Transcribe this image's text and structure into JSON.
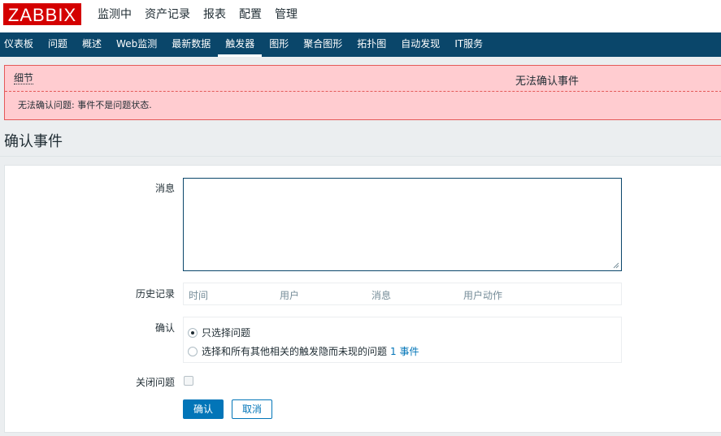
{
  "brand": {
    "logo_text": "ZABBIX",
    "logo_color": "#d40000"
  },
  "top_menu": {
    "items": [
      {
        "label": "监测中",
        "active": true
      },
      {
        "label": "资产记录"
      },
      {
        "label": "报表"
      },
      {
        "label": "配置"
      },
      {
        "label": "管理"
      }
    ]
  },
  "sub_menu": {
    "items": [
      {
        "label": "仪表板"
      },
      {
        "label": "问题"
      },
      {
        "label": "概述"
      },
      {
        "label": "Web监测"
      },
      {
        "label": "最新数据"
      },
      {
        "label": "触发器",
        "active": true
      },
      {
        "label": "图形"
      },
      {
        "label": "聚合图形"
      },
      {
        "label": "拓扑图"
      },
      {
        "label": "自动发现"
      },
      {
        "label": "IT服务"
      }
    ]
  },
  "error": {
    "details_label": "细节",
    "title": "无法确认事件",
    "message": "无法确认问题: 事件不是问题状态."
  },
  "page": {
    "title": "确认事件"
  },
  "form": {
    "message_label": "消息",
    "message_value": "",
    "history_label": "历史记录",
    "history_columns": [
      "时间",
      "用户",
      "消息",
      "用户动作"
    ],
    "acknowledge_label": "确认",
    "options": {
      "selected_only": "只选择问题",
      "all_related": "选择和所有其他相关的触发隐而未现的问题",
      "event_count": "1 事件"
    },
    "close_problem_label": "关闭问题",
    "close_problem_checked": false,
    "submit_label": "确认",
    "cancel_label": "取消"
  },
  "colors": {
    "nav_bg": "#0a466a",
    "error_bg": "#ffccd0",
    "error_border": "#e45959",
    "primary": "#0275b8"
  }
}
